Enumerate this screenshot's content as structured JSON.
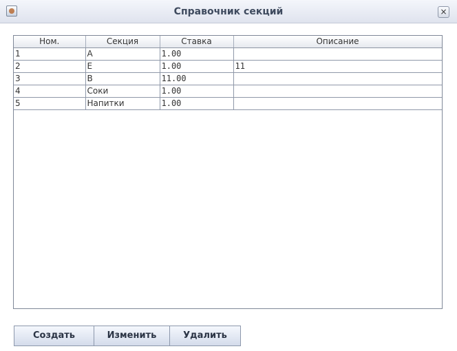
{
  "window": {
    "title": "Справочник секций",
    "close_label": "×"
  },
  "table": {
    "columns": [
      "Ном.",
      "Секция",
      "Ставка",
      "Описание"
    ],
    "rows": [
      {
        "num": "1",
        "section": "A",
        "rate": "1.00",
        "description": ""
      },
      {
        "num": "2",
        "section": "E",
        "rate": "1.00",
        "description": "11"
      },
      {
        "num": "3",
        "section": "B",
        "rate": "11.00",
        "description": ""
      },
      {
        "num": "4",
        "section": "Соки",
        "rate": "1.00",
        "description": ""
      },
      {
        "num": "5",
        "section": "Напитки",
        "rate": "1.00",
        "description": ""
      }
    ]
  },
  "buttons": {
    "create": "Создать",
    "edit": "Изменить",
    "delete": "Удалить"
  }
}
